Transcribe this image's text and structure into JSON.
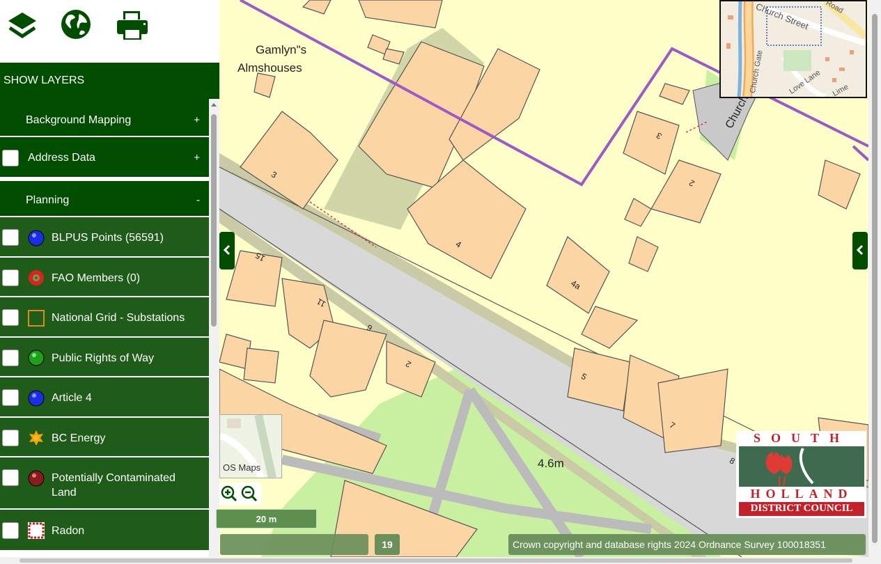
{
  "toolbar": {
    "layers_icon": "layers-icon",
    "globe_icon": "globe-icon",
    "print_icon": "print-icon"
  },
  "panel": {
    "header": "SHOW LAYERS"
  },
  "layers": {
    "background_mapping": {
      "label": "Background Mapping",
      "toggle": "+"
    },
    "address_data": {
      "label": "Address Data",
      "toggle": "+"
    },
    "planning": {
      "label": "Planning",
      "toggle": "-"
    },
    "items": [
      {
        "label": "BLPUS Points (56591)",
        "symbol": "blue-dot-icon"
      },
      {
        "label": "FAO Members (0)",
        "symbol": "red-rosette-icon"
      },
      {
        "label": "National Grid - Substations",
        "symbol": "orange-square-icon"
      },
      {
        "label": "Public Rights of Way",
        "symbol": "green-dot-icon"
      },
      {
        "label": "Article 4",
        "symbol": "blue-dot-icon"
      },
      {
        "label": "BC Energy",
        "symbol": "orange-star-icon"
      },
      {
        "label": "Potentially Contaminated Land",
        "symbol": "dark-red-dot-icon"
      },
      {
        "label": "Radon",
        "symbol": "red-dashed-square-icon"
      }
    ]
  },
  "map": {
    "labels": {
      "almshouses_line1": "Gamlyn\"s",
      "almshouses_line2": "Almshouses",
      "house_3": "3",
      "house_4": "4",
      "house_4a": "4a",
      "house_15": "15",
      "house_11": "11",
      "house_9": "9",
      "house_2a": "2",
      "house_2b": "2",
      "house_3b": "3",
      "house_5": "5",
      "house_7": "7",
      "house_8": "8",
      "height": "4.6m",
      "church_road": "Church"
    },
    "basemap_label": "OS Maps",
    "scale": "20 m",
    "zoom_level": "19",
    "copyright": "Crown copyright and database rights 2024 Ordnance Survey 100018351"
  },
  "overview": {
    "street1": "Church Street",
    "street2": "Church Gate",
    "street3": "Love Lane",
    "street4": "Road",
    "street5": "Lime"
  },
  "logo": {
    "line1": "SOUTH",
    "line2": "HOLLAND",
    "line3": "DISTRICT COUNCIL"
  },
  "colors": {
    "panel_dark_green": "#004d00",
    "panel_row_green": "#1f5c1a",
    "boundary_purple": "#9b59c9",
    "building_fill": "#fcd5a4",
    "land_fill": "#fefec8",
    "road_fill": "#d3d3d3",
    "park_fill": "#c8f0a0"
  }
}
